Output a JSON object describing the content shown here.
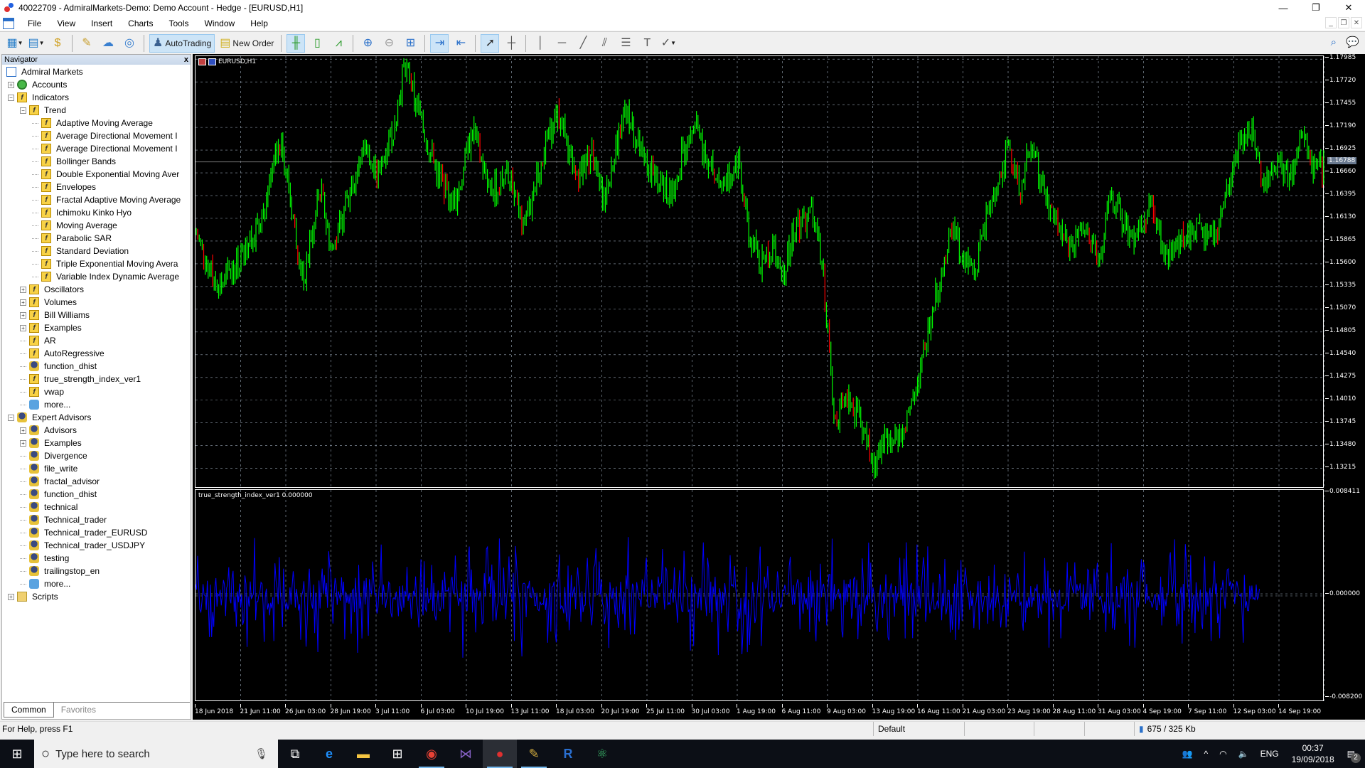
{
  "window": {
    "title": "40022709 - AdmiralMarkets-Demo: Demo Account - Hedge - [EURUSD,H1]",
    "controls": {
      "minimize": "—",
      "maximize": "❐",
      "close": "✕"
    }
  },
  "menu": [
    "File",
    "View",
    "Insert",
    "Charts",
    "Tools",
    "Window",
    "Help"
  ],
  "toolbar": {
    "autotrading_label": "AutoTrading",
    "new_order_label": "New Order"
  },
  "navigator": {
    "title": "Navigator",
    "close": "x",
    "root": "Admiral Markets",
    "items": [
      {
        "label": "Accounts",
        "level": 1,
        "icon": "accounts-icon",
        "expander": "+"
      },
      {
        "label": "Indicators",
        "level": 1,
        "icon": "indicator-icon",
        "expander": "−"
      },
      {
        "label": "Trend",
        "level": 2,
        "icon": "indicator-icon",
        "expander": "−"
      },
      {
        "label": "Adaptive Moving Average",
        "level": 3,
        "icon": "indicator-icon"
      },
      {
        "label": "Average Directional Movement I",
        "level": 3,
        "icon": "indicator-icon"
      },
      {
        "label": "Average Directional Movement I",
        "level": 3,
        "icon": "indicator-icon"
      },
      {
        "label": "Bollinger Bands",
        "level": 3,
        "icon": "indicator-icon"
      },
      {
        "label": "Double Exponential Moving Aver",
        "level": 3,
        "icon": "indicator-icon"
      },
      {
        "label": "Envelopes",
        "level": 3,
        "icon": "indicator-icon"
      },
      {
        "label": "Fractal Adaptive Moving Average",
        "level": 3,
        "icon": "indicator-icon"
      },
      {
        "label": "Ichimoku Kinko Hyo",
        "level": 3,
        "icon": "indicator-icon"
      },
      {
        "label": "Moving Average",
        "level": 3,
        "icon": "indicator-icon"
      },
      {
        "label": "Parabolic SAR",
        "level": 3,
        "icon": "indicator-icon"
      },
      {
        "label": "Standard Deviation",
        "level": 3,
        "icon": "indicator-icon"
      },
      {
        "label": "Triple Exponential Moving Avera",
        "level": 3,
        "icon": "indicator-icon"
      },
      {
        "label": "Variable Index Dynamic Average",
        "level": 3,
        "icon": "indicator-icon"
      },
      {
        "label": "Oscillators",
        "level": 2,
        "icon": "indicator-icon",
        "expander": "+"
      },
      {
        "label": "Volumes",
        "level": 2,
        "icon": "indicator-icon",
        "expander": "+"
      },
      {
        "label": "Bill Williams",
        "level": 2,
        "icon": "indicator-icon",
        "expander": "+"
      },
      {
        "label": "Examples",
        "level": 2,
        "icon": "custom-indicator-icon",
        "expander": "+"
      },
      {
        "label": "AR",
        "level": 2,
        "icon": "custom-indicator-icon"
      },
      {
        "label": "AutoRegressive",
        "level": 2,
        "icon": "custom-indicator-icon"
      },
      {
        "label": "function_dhist",
        "level": 2,
        "icon": "expert-advisor-icon"
      },
      {
        "label": "true_strength_index_ver1",
        "level": 2,
        "icon": "custom-indicator-icon"
      },
      {
        "label": "vwap",
        "level": 2,
        "icon": "custom-indicator-icon"
      },
      {
        "label": "more...",
        "level": 2,
        "icon": "download-more-icon"
      },
      {
        "label": "Expert Advisors",
        "level": 1,
        "icon": "expert-advisor-icon",
        "expander": "−"
      },
      {
        "label": "Advisors",
        "level": 2,
        "icon": "expert-advisor-icon",
        "expander": "+"
      },
      {
        "label": "Examples",
        "level": 2,
        "icon": "expert-advisor-icon",
        "expander": "+"
      },
      {
        "label": "Divergence",
        "level": 2,
        "icon": "expert-advisor-icon"
      },
      {
        "label": "file_write",
        "level": 2,
        "icon": "expert-advisor-icon"
      },
      {
        "label": "fractal_advisor",
        "level": 2,
        "icon": "expert-advisor-icon"
      },
      {
        "label": "function_dhist",
        "level": 2,
        "icon": "expert-advisor-icon"
      },
      {
        "label": "technical",
        "level": 2,
        "icon": "expert-advisor-icon"
      },
      {
        "label": "Technical_trader",
        "level": 2,
        "icon": "expert-advisor-icon"
      },
      {
        "label": "Technical_trader_EURUSD",
        "level": 2,
        "icon": "expert-advisor-icon"
      },
      {
        "label": "Technical_trader_USDJPY",
        "level": 2,
        "icon": "expert-advisor-icon"
      },
      {
        "label": "testing",
        "level": 2,
        "icon": "expert-advisor-icon"
      },
      {
        "label": "trailingstop_en",
        "level": 2,
        "icon": "expert-advisor-icon"
      },
      {
        "label": "more...",
        "level": 2,
        "icon": "download-more-icon"
      },
      {
        "label": "Scripts",
        "level": 1,
        "icon": "script-icon",
        "expander": "+"
      }
    ],
    "tabs": [
      "Common",
      "Favorites"
    ],
    "active_tab": "Common"
  },
  "chart": {
    "symbol_label": "EURUSD,H1",
    "indicator_label": "true_strength_index_ver1 0.000000",
    "current_price": "1.16788",
    "price_axis": [
      "1.17985",
      "1.17720",
      "1.17455",
      "1.17190",
      "1.16925",
      "1.16660",
      "1.16395",
      "1.16130",
      "1.15865",
      "1.15600",
      "1.15335",
      "1.15070",
      "1.14805",
      "1.14540",
      "1.14275",
      "1.14010",
      "1.13745",
      "1.13480",
      "1.13215"
    ],
    "price_range": [
      1.1298,
      1.1802
    ],
    "indicator_axis": {
      "max": "0.008411",
      "zero": "0.000000",
      "min": "-0.008200"
    },
    "time_axis": [
      "18 Jun 2018",
      "21 Jun 11:00",
      "26 Jun 03:00",
      "28 Jun 19:00",
      "3 Jul 11:00",
      "6 Jul 03:00",
      "10 Jul 19:00",
      "13 Jul 11:00",
      "18 Jul 03:00",
      "20 Jul 19:00",
      "25 Jul 11:00",
      "30 Jul 03:00",
      "1 Aug 19:00",
      "6 Aug 11:00",
      "9 Aug 03:00",
      "13 Aug 19:00",
      "16 Aug 11:00",
      "21 Aug 03:00",
      "23 Aug 19:00",
      "28 Aug 11:00",
      "31 Aug 03:00",
      "4 Sep 19:00",
      "7 Sep 11:00",
      "12 Sep 03:00",
      "14 Sep 19:00"
    ],
    "colors": {
      "bull": "#00ff00",
      "bear": "#ff0000",
      "indicator": "#0000ff",
      "grid": "#9aa8b8"
    },
    "price_path": [
      [
        0,
        1.1595
      ],
      [
        0.02,
        1.153
      ],
      [
        0.04,
        1.157
      ],
      [
        0.06,
        1.162
      ],
      [
        0.075,
        1.171
      ],
      [
        0.085,
        1.162
      ],
      [
        0.095,
        1.154
      ],
      [
        0.11,
        1.165
      ],
      [
        0.12,
        1.157
      ],
      [
        0.14,
        1.166
      ],
      [
        0.15,
        1.17
      ],
      [
        0.16,
        1.166
      ],
      [
        0.175,
        1.172
      ],
      [
        0.185,
        1.1795
      ],
      [
        0.2,
        1.172
      ],
      [
        0.215,
        1.166
      ],
      [
        0.23,
        1.163
      ],
      [
        0.245,
        1.172
      ],
      [
        0.26,
        1.164
      ],
      [
        0.275,
        1.167
      ],
      [
        0.29,
        1.16
      ],
      [
        0.3,
        1.165
      ],
      [
        0.32,
        1.174
      ],
      [
        0.335,
        1.166
      ],
      [
        0.35,
        1.169
      ],
      [
        0.36,
        1.163
      ],
      [
        0.38,
        1.174
      ],
      [
        0.4,
        1.167
      ],
      [
        0.42,
        1.164
      ],
      [
        0.44,
        1.173
      ],
      [
        0.455,
        1.167
      ],
      [
        0.47,
        1.165
      ],
      [
        0.48,
        1.1685
      ],
      [
        0.49,
        1.159
      ],
      [
        0.5,
        1.156
      ],
      [
        0.51,
        1.158
      ],
      [
        0.52,
        1.155
      ],
      [
        0.53,
        1.16
      ],
      [
        0.545,
        1.162
      ],
      [
        0.555,
        1.1555
      ],
      [
        0.56,
        1.147
      ],
      [
        0.565,
        1.138
      ],
      [
        0.58,
        1.14
      ],
      [
        0.59,
        1.137
      ],
      [
        0.6,
        1.1325
      ],
      [
        0.61,
        1.136
      ],
      [
        0.625,
        1.1365
      ],
      [
        0.64,
        1.142
      ],
      [
        0.65,
        1.15
      ],
      [
        0.66,
        1.155
      ],
      [
        0.67,
        1.16
      ],
      [
        0.68,
        1.157
      ],
      [
        0.69,
        1.155
      ],
      [
        0.7,
        1.161
      ],
      [
        0.71,
        1.165
      ],
      [
        0.72,
        1.17
      ],
      [
        0.73,
        1.165
      ],
      [
        0.74,
        1.17
      ],
      [
        0.75,
        1.165
      ],
      [
        0.76,
        1.161
      ],
      [
        0.775,
        1.158
      ],
      [
        0.79,
        1.16
      ],
      [
        0.8,
        1.156
      ],
      [
        0.81,
        1.164
      ],
      [
        0.83,
        1.158
      ],
      [
        0.845,
        1.163
      ],
      [
        0.86,
        1.157
      ],
      [
        0.875,
        1.159
      ],
      [
        0.89,
        1.16
      ],
      [
        0.905,
        1.16
      ],
      [
        0.92,
        1.169
      ],
      [
        0.935,
        1.172
      ],
      [
        0.945,
        1.165
      ],
      [
        0.955,
        1.168
      ],
      [
        0.97,
        1.166
      ],
      [
        0.98,
        1.171
      ],
      [
        0.99,
        1.167
      ],
      [
        1,
        1.167
      ]
    ]
  },
  "statusbar": {
    "help": "For Help, press F1",
    "profile": "Default",
    "traffic": "675 / 325 Kb"
  },
  "taskbar": {
    "search_placeholder": "Type here to search",
    "language": "ENG",
    "time": "00:37",
    "date": "19/09/2018",
    "notification_count": "2"
  }
}
